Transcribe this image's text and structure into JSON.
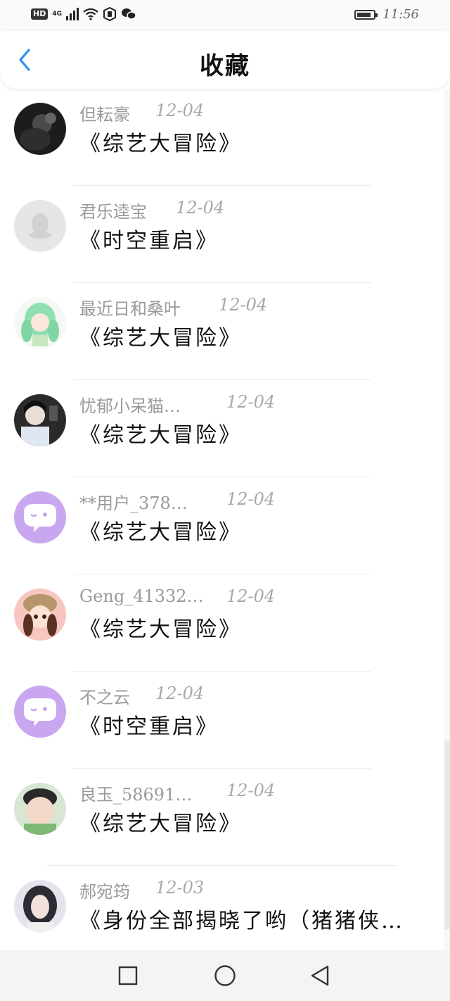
{
  "status_bar": {
    "hd": "HD",
    "network": "4G",
    "time": "11:56",
    "icons": [
      "hd-icon",
      "signal-icon",
      "wifi-icon",
      "shield-icon",
      "wechat-icon",
      "battery-icon"
    ]
  },
  "header": {
    "title": "收藏",
    "back_icon": "chevron-left-icon",
    "accent": "#2a8ff0"
  },
  "favorites": [
    {
      "user": "但耘豪",
      "date": "12-04",
      "title": "《综艺大冒险》",
      "avatar": "photo-dark"
    },
    {
      "user": "君乐逵宝",
      "date": "12-04",
      "title": "《时空重启》",
      "avatar": "default-penguin"
    },
    {
      "user": "最近日和桑叶",
      "date": "12-04",
      "title": "《综艺大冒险》",
      "avatar": "anime-green"
    },
    {
      "user": "忧郁小呆猫…",
      "date": "12-04",
      "title": "《综艺大冒险》",
      "avatar": "photo-selfie"
    },
    {
      "user": "**用户_378…",
      "date": "12-04",
      "title": "《综艺大冒险》",
      "avatar": "purple-chat"
    },
    {
      "user": "Geng_41332…",
      "date": "12-04",
      "title": "《综艺大冒险》",
      "avatar": "cartoon-girl"
    },
    {
      "user": "不之云",
      "date": "12-04",
      "title": "《时空重启》",
      "avatar": "purple-chat"
    },
    {
      "user": "良玉_58691…",
      "date": "12-04",
      "title": "《综艺大冒险》",
      "avatar": "photo-kid"
    },
    {
      "user": "郝宛筠",
      "date": "12-03",
      "title": "《身份全部揭晓了哟（猪猪侠…",
      "avatar": "photo-girl"
    }
  ],
  "bottom_nav": {
    "icons": [
      "recent-apps-icon",
      "home-icon",
      "back-triangle-icon"
    ]
  }
}
